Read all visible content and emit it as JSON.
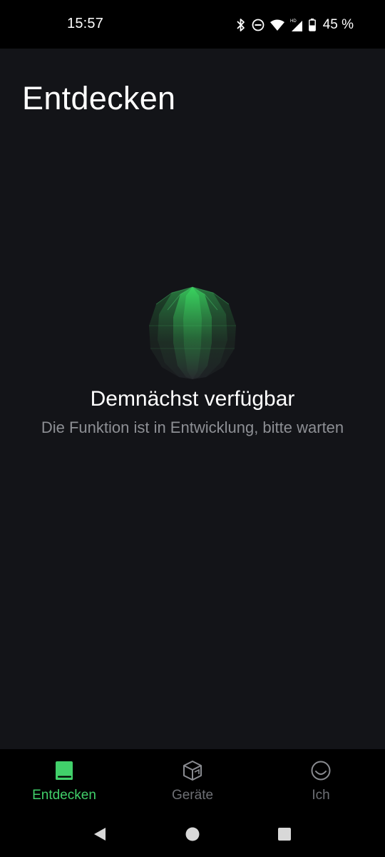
{
  "status_bar": {
    "time": "15:57",
    "battery": "45 %",
    "icons": [
      "bluetooth-icon",
      "do-not-disturb-icon",
      "wifi-icon",
      "hd-signal-icon",
      "battery-icon"
    ]
  },
  "header": {
    "title": "Entdecken"
  },
  "empty_state": {
    "illustration": "green-globe-icon",
    "title": "Demnächst verfügbar",
    "subtitle": "Die Funktion ist in Entwicklung, bitte warten"
  },
  "bottom_nav": {
    "items": [
      {
        "label": "Entdecken",
        "icon": "book-icon",
        "active": true
      },
      {
        "label": "Geräte",
        "icon": "cube-icon",
        "active": false
      },
      {
        "label": "Ich",
        "icon": "smile-icon",
        "active": false
      }
    ]
  },
  "system_nav": {
    "buttons": [
      "back-icon",
      "home-icon",
      "recents-icon"
    ]
  },
  "colors": {
    "background": "#131418",
    "bar_background": "#000000",
    "accent": "#41d06a",
    "inactive": "#6e7075",
    "subtitle": "#8d8f94"
  }
}
